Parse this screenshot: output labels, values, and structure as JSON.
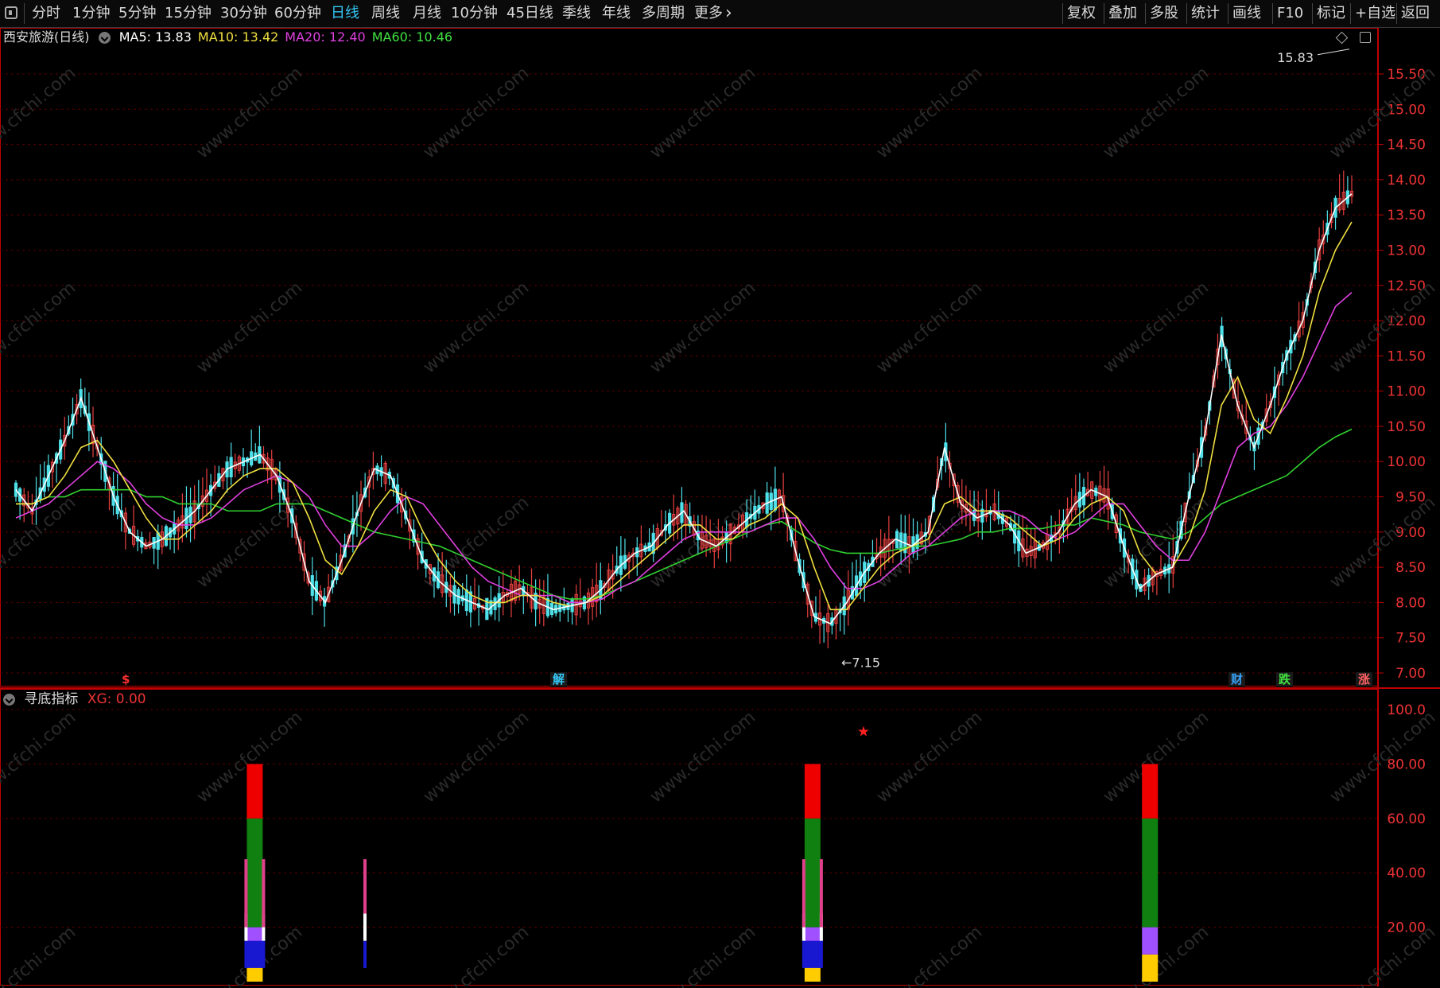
{
  "toolbar": {
    "periods": [
      {
        "label": "分时",
        "active": false
      },
      {
        "label": "1分钟",
        "active": false
      },
      {
        "label": "5分钟",
        "active": false
      },
      {
        "label": "15分钟",
        "active": false
      },
      {
        "label": "30分钟",
        "active": false
      },
      {
        "label": "60分钟",
        "active": false
      },
      {
        "label": "日线",
        "active": true
      },
      {
        "label": "周线",
        "active": false
      },
      {
        "label": "月线",
        "active": false
      },
      {
        "label": "10分钟",
        "active": false
      },
      {
        "label": "45日线",
        "active": false
      },
      {
        "label": "季线",
        "active": false
      },
      {
        "label": "年线",
        "active": false
      },
      {
        "label": "多周期",
        "active": false
      },
      {
        "label": "更多",
        "active": false
      }
    ],
    "tools": [
      "复权",
      "叠加",
      "多股",
      "统计",
      "画线",
      "F10",
      "标记",
      "+自选",
      "返回"
    ]
  },
  "stock": {
    "title": "西安旅游(日线)",
    "ma": [
      {
        "label": "MA5: 13.83",
        "color": "#ffffff"
      },
      {
        "label": "MA10: 13.42",
        "color": "#f0e040"
      },
      {
        "label": "MA20: 12.40",
        "color": "#e040e0"
      },
      {
        "label": "MA60: 10.46",
        "color": "#40e040"
      }
    ]
  },
  "indicator": {
    "name": "寻底指标",
    "xg_label": "XG: 0.00"
  },
  "price_axis": [
    "15.50",
    "15.00",
    "14.50",
    "14.00",
    "13.50",
    "13.00",
    "12.50",
    "12.00",
    "11.50",
    "11.00",
    "10.50",
    "10.00",
    "9.50",
    "9.00",
    "8.50",
    "8.00",
    "7.50",
    "7.00"
  ],
  "indicator_axis": [
    "100.0",
    "80.00",
    "60.00",
    "40.00",
    "20.00"
  ],
  "annotations": {
    "high": "15.83",
    "low": "7.15"
  },
  "events": [
    {
      "text": "$",
      "color": "#ff3030"
    },
    {
      "text": "解",
      "color": "#34c6f4"
    },
    {
      "text": "财",
      "color": "#34a0f4"
    },
    {
      "text": "跌",
      "color": "#40e040"
    },
    {
      "text": "涨",
      "color": "#ff6060"
    }
  ],
  "watermark": "www.cfchi.com",
  "chart_data": {
    "type": "candlestick",
    "ylim": [
      7.0,
      15.75
    ],
    "indicator_ylim": [
      0,
      100
    ],
    "ma_close": [
      9.6,
      9.3,
      9.8,
      10.3,
      10.9,
      10.2,
      9.5,
      9.0,
      8.8,
      8.9,
      9.1,
      9.3,
      9.6,
      9.9,
      10.0,
      10.1,
      9.8,
      9.2,
      8.3,
      8.0,
      8.6,
      9.3,
      9.9,
      9.8,
      9.2,
      8.6,
      8.3,
      8.1,
      8.0,
      7.9,
      8.1,
      8.2,
      8.0,
      7.9,
      7.95,
      8.0,
      8.2,
      8.5,
      8.7,
      8.8,
      9.1,
      9.3,
      8.9,
      8.8,
      9.0,
      9.2,
      9.4,
      9.5,
      8.6,
      7.8,
      7.7,
      8.0,
      8.4,
      8.7,
      8.9,
      8.8,
      9.0,
      10.2,
      9.4,
      9.2,
      9.3,
      9.1,
      8.7,
      8.8,
      9.0,
      9.4,
      9.6,
      9.5,
      8.8,
      8.2,
      8.4,
      8.5,
      9.5,
      10.4,
      11.8,
      10.8,
      10.2,
      10.8,
      11.5,
      12.0,
      13.0,
      13.6,
      13.8
    ],
    "ma10": [
      9.4,
      9.4,
      9.5,
      9.8,
      10.2,
      10.3,
      10.0,
      9.6,
      9.2,
      8.9,
      8.9,
      9.1,
      9.3,
      9.6,
      9.8,
      9.9,
      9.9,
      9.7,
      9.2,
      8.6,
      8.4,
      8.8,
      9.3,
      9.6,
      9.5,
      9.0,
      8.6,
      8.3,
      8.1,
      8.0,
      8.0,
      8.1,
      8.1,
      8.0,
      7.95,
      8.0,
      8.1,
      8.3,
      8.5,
      8.7,
      8.9,
      9.1,
      9.1,
      8.9,
      8.9,
      9.1,
      9.2,
      9.4,
      9.2,
      8.5,
      7.9,
      7.9,
      8.2,
      8.5,
      8.7,
      8.8,
      8.9,
      9.4,
      9.5,
      9.3,
      9.3,
      9.2,
      9.0,
      8.8,
      8.9,
      9.2,
      9.4,
      9.5,
      9.3,
      8.7,
      8.4,
      8.5,
      8.9,
      9.6,
      10.8,
      11.2,
      10.6,
      10.4,
      10.9,
      11.5,
      12.4,
      13.0,
      13.4
    ],
    "ma20": [
      9.2,
      9.3,
      9.4,
      9.6,
      9.8,
      10.0,
      9.9,
      9.7,
      9.4,
      9.2,
      9.1,
      9.1,
      9.2,
      9.4,
      9.6,
      9.7,
      9.8,
      9.7,
      9.5,
      9.1,
      8.8,
      8.8,
      9.0,
      9.3,
      9.5,
      9.4,
      9.1,
      8.8,
      8.5,
      8.3,
      8.2,
      8.1,
      8.1,
      8.1,
      8.0,
      8.0,
      8.05,
      8.2,
      8.3,
      8.5,
      8.7,
      8.9,
      9.0,
      9.0,
      9.0,
      9.0,
      9.1,
      9.2,
      9.2,
      8.9,
      8.5,
      8.2,
      8.2,
      8.3,
      8.5,
      8.7,
      8.8,
      9.0,
      9.2,
      9.3,
      9.3,
      9.3,
      9.2,
      9.0,
      8.9,
      9.0,
      9.2,
      9.4,
      9.4,
      9.1,
      8.8,
      8.6,
      8.6,
      9.0,
      9.6,
      10.2,
      10.4,
      10.5,
      10.8,
      11.2,
      11.7,
      12.2,
      12.4
    ],
    "ma60": [
      9.4,
      9.4,
      9.5,
      9.5,
      9.6,
      9.6,
      9.6,
      9.6,
      9.5,
      9.5,
      9.4,
      9.4,
      9.4,
      9.3,
      9.3,
      9.3,
      9.4,
      9.4,
      9.4,
      9.3,
      9.2,
      9.1,
      9.0,
      8.95,
      8.9,
      8.85,
      8.8,
      8.7,
      8.6,
      8.5,
      8.4,
      8.3,
      8.2,
      8.1,
      8.05,
      8.05,
      8.1,
      8.2,
      8.3,
      8.4,
      8.5,
      8.6,
      8.7,
      8.8,
      8.9,
      9.0,
      9.1,
      9.15,
      9.0,
      8.85,
      8.75,
      8.7,
      8.7,
      8.7,
      8.75,
      8.8,
      8.8,
      8.85,
      8.9,
      9.0,
      9.0,
      9.05,
      9.05,
      9.05,
      9.1,
      9.1,
      9.2,
      9.15,
      9.1,
      9.0,
      8.95,
      8.9,
      9.0,
      9.2,
      9.4,
      9.5,
      9.6,
      9.7,
      9.8,
      10.0,
      10.2,
      10.35,
      10.46
    ],
    "signals": [
      {
        "x": 0.185,
        "segments": [
          [
            0,
            10,
            "#ffcc00"
          ],
          [
            10,
            20,
            "#a050ff"
          ],
          [
            20,
            60,
            "#108010"
          ],
          [
            60,
            80,
            "#ee0000"
          ]
        ],
        "pink": [
          20,
          45
        ],
        "white": [
          15,
          25
        ],
        "blue": [
          5,
          15
        ]
      },
      {
        "x": 0.265,
        "segments": [],
        "pink": [
          25,
          45
        ],
        "white": [
          15,
          25
        ],
        "blue": [
          5,
          15
        ]
      },
      {
        "x": 0.59,
        "segments": [
          [
            0,
            10,
            "#ffcc00"
          ],
          [
            10,
            20,
            "#a050ff"
          ],
          [
            20,
            60,
            "#108010"
          ],
          [
            60,
            80,
            "#ee0000"
          ]
        ],
        "pink": [
          20,
          45
        ],
        "white": [
          15,
          25
        ],
        "blue": [
          5,
          15
        ]
      },
      {
        "x": 0.835,
        "segments": [
          [
            0,
            10,
            "#ffcc00"
          ],
          [
            10,
            20,
            "#a050ff"
          ],
          [
            20,
            60,
            "#108010"
          ],
          [
            60,
            80,
            "#ee0000"
          ]
        ],
        "pink": null,
        "white": null,
        "blue": null
      }
    ],
    "star_value": 92
  }
}
